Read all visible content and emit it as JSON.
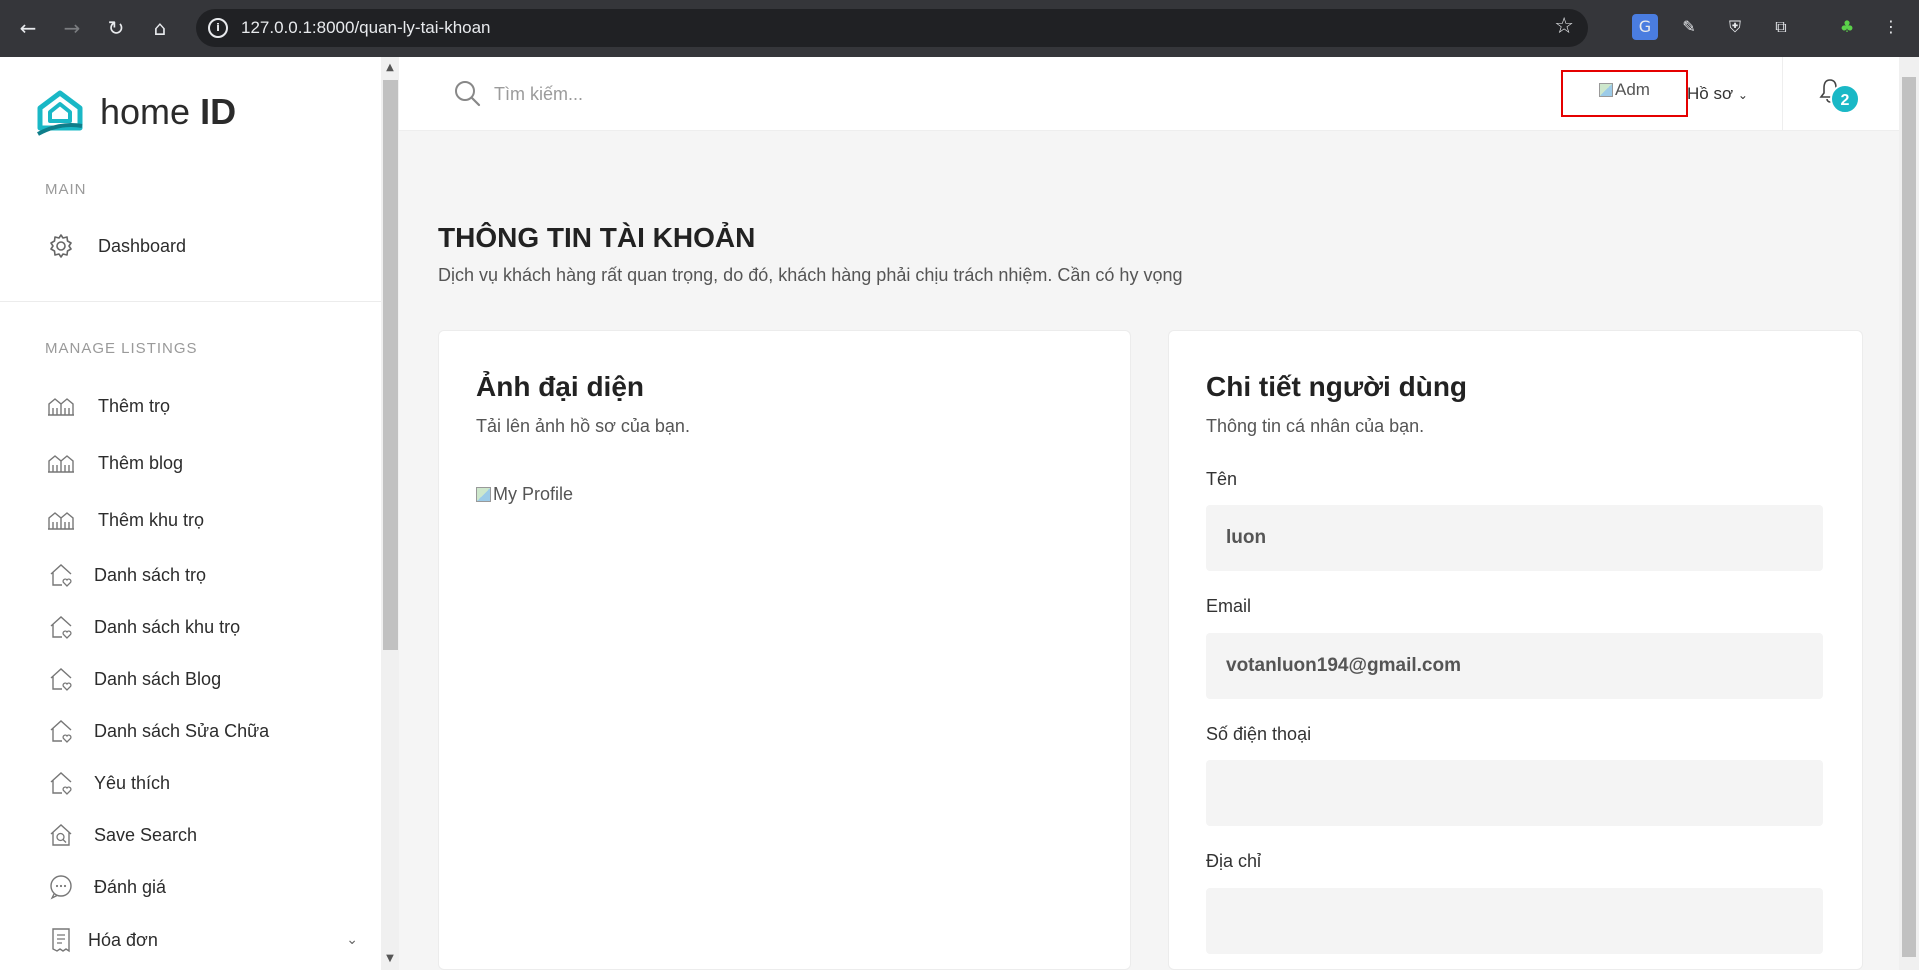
{
  "browser": {
    "url": "127.0.0.1:8000/quan-ly-tai-khoan"
  },
  "sidebar": {
    "logo_text_light": "home",
    "logo_text_bold": "ID",
    "main_title": "MAIN",
    "main_items": [
      {
        "label": "Dashboard",
        "icon": "gear-icon"
      }
    ],
    "listings_title": "MANAGE LISTINGS",
    "listing_items": [
      {
        "label": "Thêm trọ",
        "icon": "building-icon"
      },
      {
        "label": "Thêm blog",
        "icon": "building-icon"
      },
      {
        "label": "Thêm khu trọ",
        "icon": "building-icon"
      },
      {
        "label": "Danh sách trọ",
        "icon": "house-heart-icon"
      },
      {
        "label": "Danh sách khu trọ",
        "icon": "house-heart-icon"
      },
      {
        "label": "Danh sách Blog",
        "icon": "house-heart-icon"
      },
      {
        "label": "Danh sách Sửa Chữa",
        "icon": "house-heart-icon"
      },
      {
        "label": "Yêu thích",
        "icon": "house-heart-icon"
      },
      {
        "label": "Save Search",
        "icon": "house-search-icon"
      },
      {
        "label": "Đánh giá",
        "icon": "chat-bubble-icon"
      },
      {
        "label": "Hóa đơn",
        "icon": "invoice-icon"
      }
    ]
  },
  "topbar": {
    "search_placeholder": "Tìm kiếm...",
    "admin_alt": "Adm",
    "profile_label": "Hồ sơ",
    "notification_count": "2"
  },
  "main": {
    "title": "THÔNG TIN TÀI KHOẢN",
    "subtitle": "Dịch vụ khách hàng rất quan trọng, do đó, khách hàng phải chịu trách nhiệm. Cần có hy vọng",
    "avatar_card": {
      "title": "Ảnh đại diện",
      "subtitle": "Tải lên ảnh hồ sơ của bạn.",
      "image_alt": "My Profile"
    },
    "details_card": {
      "title": "Chi tiết người dùng",
      "subtitle": "Thông tin cá nhân của bạn.",
      "fields": [
        {
          "label": "Tên",
          "value": "luon"
        },
        {
          "label": "Email",
          "value": "votanluon194@gmail.com"
        },
        {
          "label": "Số điện thoại",
          "value": ""
        },
        {
          "label": "Địa chỉ",
          "value": ""
        }
      ]
    }
  },
  "colors": {
    "accent": "#1ab8c6",
    "highlight_box": "#e50000"
  }
}
